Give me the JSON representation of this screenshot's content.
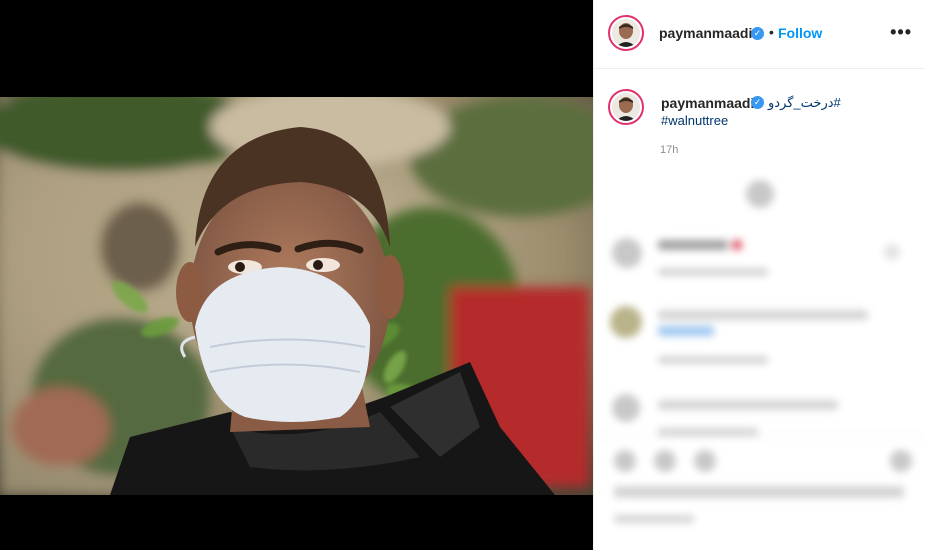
{
  "post": {
    "username": "paymanmaadi",
    "follow_label": "Follow",
    "separator": "•",
    "more_label": "•••",
    "caption_hashtag_fa": "#درخت_گردو",
    "caption_hashtag_en": "#walnuttree",
    "timestamp": "17h"
  },
  "colors": {
    "follow": "#0095f6",
    "verified": "#3897f0",
    "hashtag": "#00376b",
    "avatar_ring": "#e1306c"
  }
}
